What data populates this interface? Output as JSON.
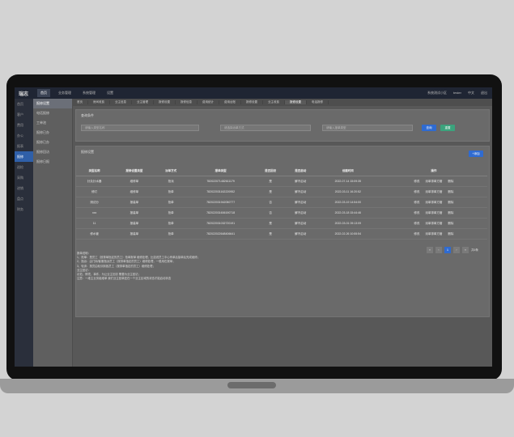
{
  "app": {
    "logo": "瑞志",
    "topnav": [
      "首页",
      "业务管理",
      "系统管理",
      "设置"
    ],
    "topright": [
      "系统测试小区",
      "tester",
      "中文",
      "退出"
    ]
  },
  "sidebar": {
    "items": [
      "首页",
      "客户",
      "费用",
      "办公",
      "报表",
      "报修",
      "巡检",
      "采购",
      "进销",
      "盘点",
      "财务"
    ],
    "active_index": 5
  },
  "subnav": {
    "items": [
      "报修设置",
      "电话报修",
      "工单池",
      "报修已办",
      "报修已办",
      "报修回访",
      "报修日报"
    ],
    "active_index": 0
  },
  "tabs": [
    "首页",
    "房间收费",
    "业主信息",
    "业主管理",
    "报修设置",
    "报修信息",
    "费用统计",
    "费用台账",
    "报修设置",
    "业主收费",
    "报修设置",
    "电话报修"
  ],
  "search": {
    "title": "查询条件",
    "name_placeholder": "请输入类型名称",
    "method_placeholder": "请选择派单方式",
    "type_placeholder": "请输入报单类型",
    "query_btn": "查询",
    "reset_btn": "重置"
  },
  "list": {
    "title": "报修设置",
    "add_btn": "+添加",
    "columns": [
      "类型名称",
      "报修设置类型",
      "派单方式",
      "报单类型",
      "是否回访",
      "是否启动",
      "创建时间",
      "操作"
    ],
    "rows": [
      [
        "针灸针水器",
        "维修单",
        "抢派",
        "782022071482611179",
        "是",
        "解不启动",
        "2022-07-14 15:09:35"
      ],
      [
        "修灯",
        "维修单",
        "抢单",
        "782022031162220952",
        "是",
        "解不启动",
        "2022-03-11 16:20:52"
      ],
      [
        "测试分",
        "报装单",
        "抢单",
        "782022031942050777",
        "否",
        "解不启动",
        "2022-03-19 14:54:00"
      ],
      [
        "xxx",
        "报装单",
        "抢单",
        "782022031606190718",
        "否",
        "解不启动",
        "2022-03-18 15:44:46"
      ],
      [
        "11",
        "报装单",
        "抢单",
        "782022031032720191",
        "是",
        "解不启动",
        "2022-03-01 09:13:09"
      ],
      [
        "修水管",
        "报装单",
        "抢单",
        "782022022648406641",
        "是",
        "解不启动",
        "2022-02-26 10:55:54"
      ]
    ],
    "row_ops": [
      "修改",
      "派单排单方管",
      "删除"
    ]
  },
  "pager": {
    "prev": "«",
    "prev2": "‹",
    "current": "1",
    "next": "›",
    "next2": "»",
    "total": "共6条"
  },
  "notes": [
    "报单说明：",
    "1、抢单：是员工（按排单指定的员工）抢单报单 维修处理，比如说员工中心有单后接单后完成维修；",
    "2、指派：由门岗/客服指派员工（按排单指定的员工）维修处理，一般用在报单；",
    "3、轮训：按员由轮训到各员工（按排单指定的员工）维修处理；",
    "业主回访：",
    "示范、情境、事件，为让业主回访 需要为业主回访；",
    "注意：一维主业务组维单 我们业主回单还在一个业主区域的状态才能启动状态"
  ]
}
